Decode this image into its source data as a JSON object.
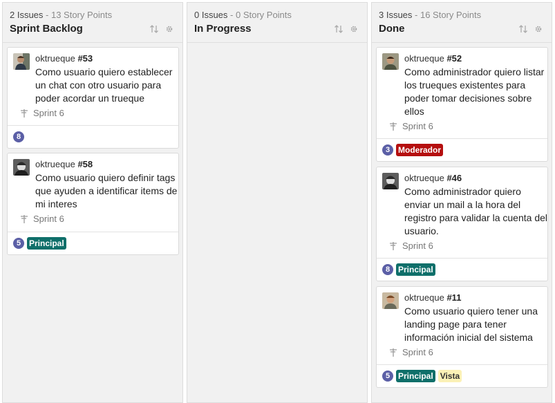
{
  "columns": [
    {
      "issues": "2 Issues",
      "points": " - 13 Story Points",
      "title": "Sprint Backlog",
      "cards": [
        {
          "user": "oktrueque",
          "number": "#53",
          "summary": "Como usuario quiero establecer un chat con otro usuario para poder acordar un trueque",
          "sprint": "Sprint 6",
          "story_points": "8",
          "labels": []
        },
        {
          "user": "oktrueque",
          "number": "#58",
          "summary": "Como usuario quiero definir tags que ayuden a identificar items de mi interes",
          "sprint": "Sprint 6",
          "story_points": "5",
          "labels": [
            {
              "text": "Principal",
              "bg": "#0f6f6a",
              "fg": "#ffffff"
            }
          ]
        }
      ]
    },
    {
      "issues": "0 Issues",
      "points": " - 0 Story Points",
      "title": "In Progress",
      "cards": []
    },
    {
      "issues": "3 Issues",
      "points": " - 16 Story Points",
      "title": "Done",
      "cards": [
        {
          "user": "oktrueque",
          "number": "#52",
          "summary": "Como administrador quiero listar los trueques existentes para poder tomar decisiones sobre ellos",
          "sprint": "Sprint 6",
          "story_points": "3",
          "labels": [
            {
              "text": "Moderador",
              "bg": "#b50f0f",
              "fg": "#ffffff"
            }
          ]
        },
        {
          "user": "oktrueque",
          "number": "#46",
          "summary": "Como administrador quiero enviar un mail a la hora del registro para validar la cuenta del usuario.",
          "sprint": "Sprint 6",
          "story_points": "8",
          "labels": [
            {
              "text": "Principal",
              "bg": "#0f6f6a",
              "fg": "#ffffff"
            }
          ]
        },
        {
          "user": "oktrueque",
          "number": "#11",
          "summary": "Como usuario quiero tener una landing page para tener información inicial del sistema",
          "sprint": "Sprint 6",
          "story_points": "5",
          "labels": [
            {
              "text": "Principal",
              "bg": "#0f6f6a",
              "fg": "#ffffff"
            },
            {
              "text": "Vista",
              "bg": "#fbf1b6",
              "fg": "#333333"
            }
          ]
        }
      ]
    }
  ],
  "icons": {
    "sort": "sort-arrows-icon",
    "settings": "gear-icon",
    "sprint": "signpost-icon"
  },
  "colors": {
    "story_points": "#5b5fa6",
    "column_bg": "#f1f1f1"
  }
}
